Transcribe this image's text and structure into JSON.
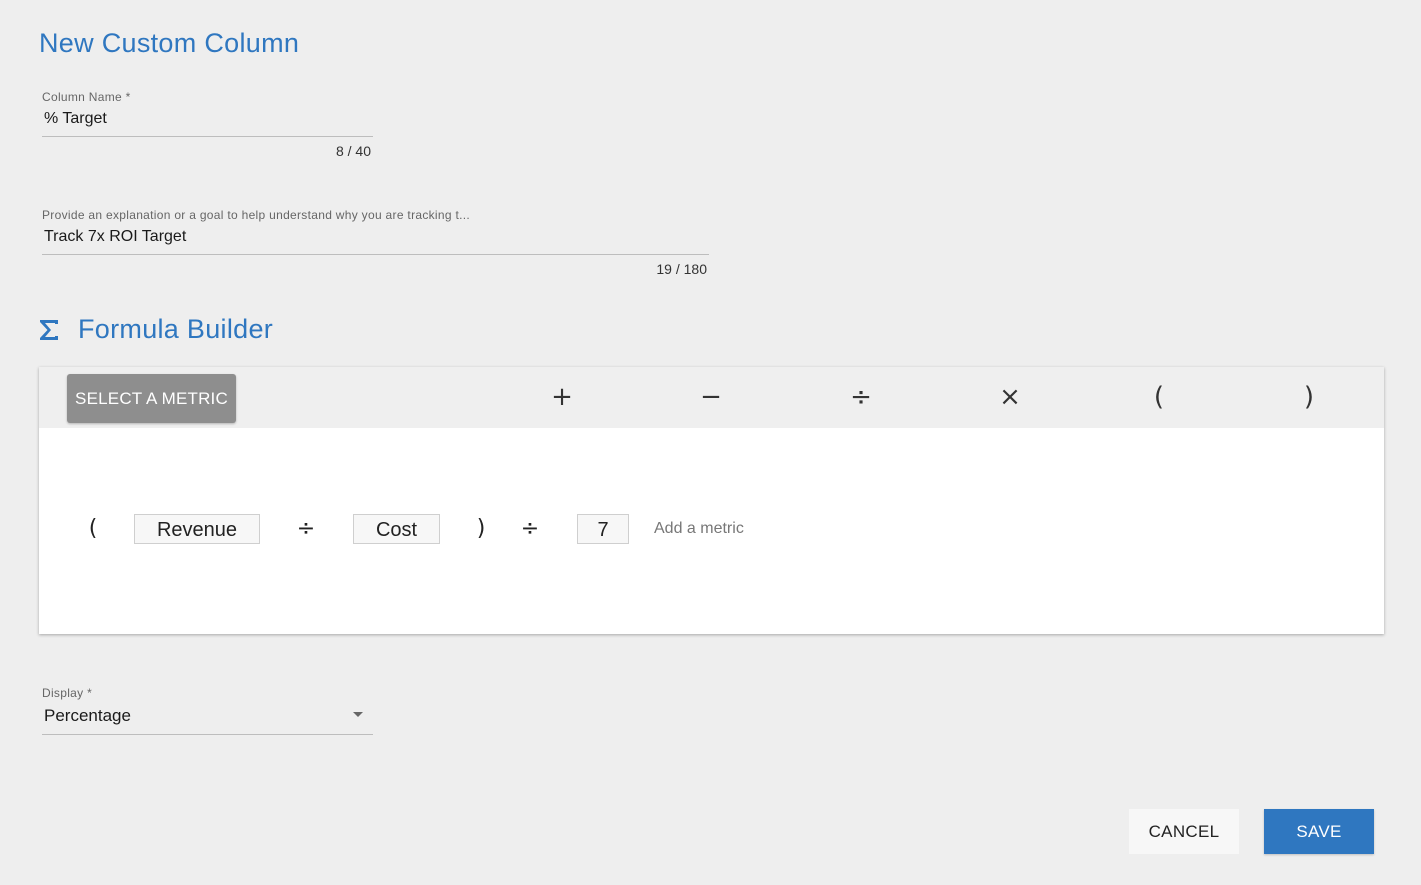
{
  "title": "New Custom Column",
  "column_name": {
    "label": "Column Name *",
    "value": "% Target",
    "counter": "8 / 40"
  },
  "explanation": {
    "label": "Provide an explanation or a goal to help understand why you are tracking t...",
    "value": "Track 7x ROI Target",
    "counter": "19 / 180"
  },
  "formula_builder": {
    "title": "Formula Builder",
    "icon": "sigma-icon",
    "select_metric_label": "SELECT A METRIC",
    "operators": [
      "+",
      "−",
      "÷",
      "×",
      "(",
      ")"
    ],
    "tokens": [
      {
        "type": "op",
        "text": "("
      },
      {
        "type": "box",
        "text": "Revenue"
      },
      {
        "type": "op",
        "text": "÷"
      },
      {
        "type": "box",
        "text": "Cost"
      },
      {
        "type": "op",
        "text": ")"
      },
      {
        "type": "op",
        "text": "÷"
      },
      {
        "type": "box",
        "text": "7"
      }
    ],
    "add_metric_placeholder": "Add a metric"
  },
  "display": {
    "label": "Display *",
    "value": "Percentage"
  },
  "actions": {
    "cancel": "CANCEL",
    "save": "SAVE"
  },
  "colors": {
    "accent": "#2f77c0",
    "select_metric_bg": "#8e8e8e"
  }
}
